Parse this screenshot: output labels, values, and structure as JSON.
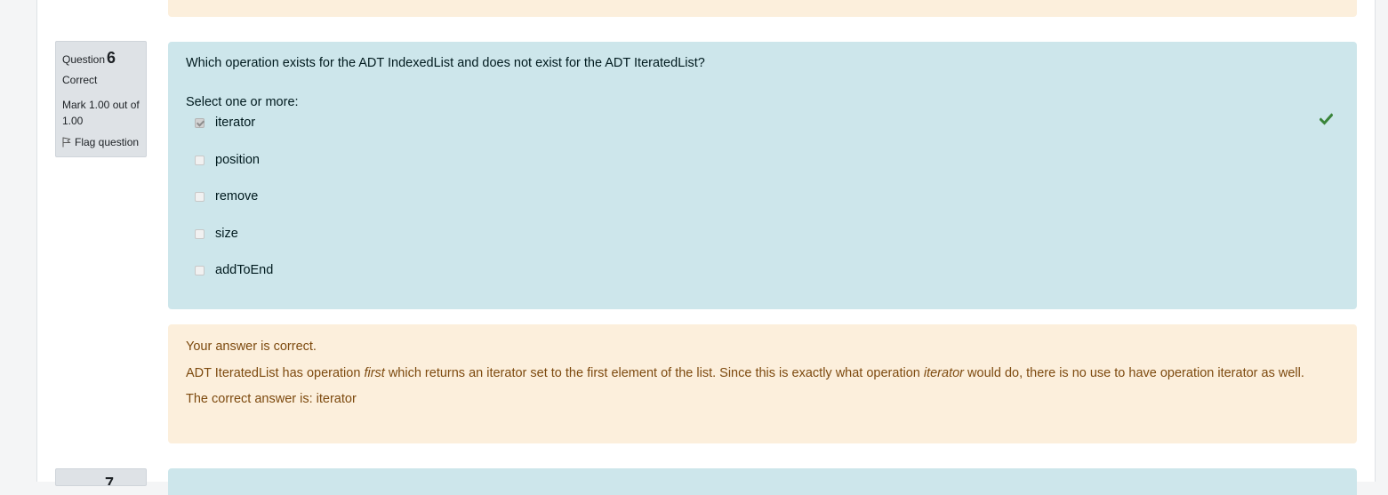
{
  "question": {
    "label": "Question",
    "number": "6",
    "state": "Correct",
    "grade": "Mark 1.00 out of 1.00",
    "flag_label": "Flag question",
    "text": "Which operation exists for the ADT IndexedList and does not exist for the ADT IteratedList?",
    "prompt": "Select one or more:",
    "answers": [
      {
        "label": "iterator",
        "checked": true
      },
      {
        "label": "position",
        "checked": false
      },
      {
        "label": "remove",
        "checked": false
      },
      {
        "label": "size",
        "checked": false
      },
      {
        "label": "addToEnd",
        "checked": false
      }
    ],
    "correct_icon": "check-icon",
    "correct_color": "#398439"
  },
  "feedback": {
    "result": "Your answer is correct.",
    "general_part1": "ADT IteratedList has operation ",
    "general_em1": "first",
    "general_part2": " which returns an iterator set to the first element of the list. Since this is exactly what operation ",
    "general_em2": "iterator",
    "general_part3": " would do, there is no use to have operation iterator as well.",
    "right_answer": "The correct answer is: iterator"
  },
  "next_question": {
    "number": "7"
  }
}
